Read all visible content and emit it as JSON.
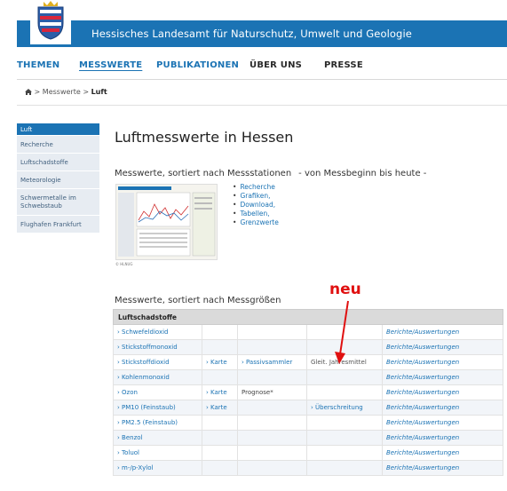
{
  "header": {
    "title": "Hessisches Landesamt für Naturschutz, Umwelt und Geologie",
    "brand_color": "#1b73b4"
  },
  "nav": {
    "items": [
      {
        "label": "THEMEN"
      },
      {
        "label": "MESSWERTE"
      },
      {
        "label": "PUBLIKATIONEN"
      },
      {
        "label": "ÜBER UNS"
      },
      {
        "label": "PRESSE"
      }
    ]
  },
  "breadcrumb": {
    "home_icon": "home-icon",
    "separator": ">",
    "item1": "Messwerte",
    "item2": "Luft"
  },
  "sidebar": {
    "items": [
      {
        "label": "Luft"
      },
      {
        "label": "Recherche"
      },
      {
        "label": "Luftschadstoffe"
      },
      {
        "label": "Meteorologie"
      },
      {
        "label": "Schwermetalle im Schwebstaub"
      },
      {
        "label": "Flughafen Frankfurt"
      }
    ]
  },
  "main": {
    "title": "Luftmesswerte in Hessen",
    "section1": {
      "heading": "Messwerte, sortiert nach Messstationen",
      "subheading": "- von Messbeginn bis heute -",
      "thumbnail_caption": "© HLNUG",
      "links": [
        "Recherche",
        "Grafiken,",
        "Download,",
        "Tabellen,",
        "Grenzwerte"
      ]
    },
    "annotation": "neu",
    "section2": {
      "heading": "Messwerte, sortiert nach Messgrößen"
    },
    "table": {
      "header": "Luftschadstoffe",
      "rows": [
        {
          "name": "› Schwefeldioxid",
          "karte": "",
          "extra": "",
          "extra2": "",
          "report": "Berichte/Auswertungen"
        },
        {
          "name": "› Stickstoffmonoxid",
          "karte": "",
          "extra": "",
          "extra2": "",
          "report": "Berichte/Auswertungen"
        },
        {
          "name": "› Stickstoffdioxid",
          "karte": "› Karte",
          "extra": "› Passivsammler",
          "extra2": "Gleit. Jahresmittel",
          "report": "Berichte/Auswertungen"
        },
        {
          "name": "› Kohlenmonoxid",
          "karte": "",
          "extra": "",
          "extra2": "",
          "report": "Berichte/Auswertungen"
        },
        {
          "name": "› Ozon",
          "karte": "› Karte",
          "extra": "Prognose*",
          "extra2": "",
          "report": "Berichte/Auswertungen"
        },
        {
          "name": "› PM10 (Feinstaub)",
          "karte": "› Karte",
          "extra": "",
          "extra2": "› Überschreitung",
          "report": "Berichte/Auswertungen"
        },
        {
          "name": "› PM2.5 (Feinstaub)",
          "karte": "",
          "extra": "",
          "extra2": "",
          "report": "Berichte/Auswertungen"
        },
        {
          "name": "› Benzol",
          "karte": "",
          "extra": "",
          "extra2": "",
          "report": "Berichte/Auswertungen"
        },
        {
          "name": "› Toluol",
          "karte": "",
          "extra": "",
          "extra2": "",
          "report": "Berichte/Auswertungen"
        },
        {
          "name": "› m-/p-Xylol",
          "karte": "",
          "extra": "",
          "extra2": "",
          "report": "Berichte/Auswertungen"
        }
      ]
    }
  }
}
